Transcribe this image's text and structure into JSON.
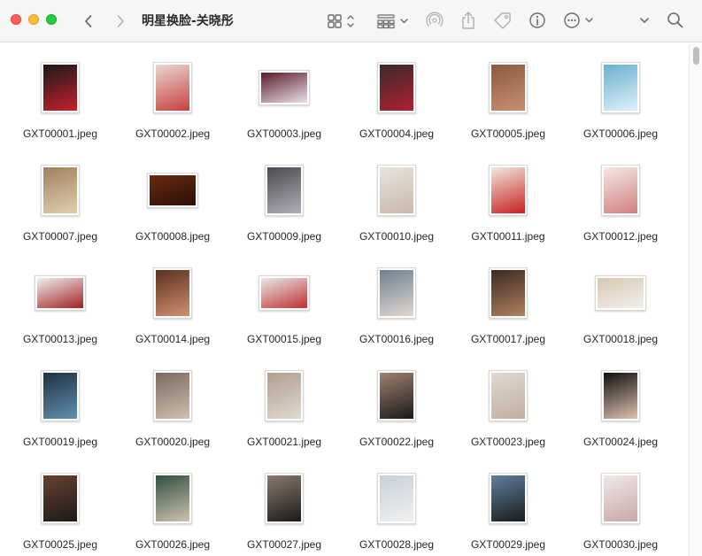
{
  "window": {
    "title": "明星换脸-关晓彤"
  },
  "toolbar": {
    "back_icon": "chevron-left-icon",
    "forward_icon": "chevron-right-icon",
    "view_icon": "icon-grid-view-icon",
    "group_icon": "group-list-icon",
    "airdrop_icon": "airdrop-icon",
    "share_icon": "share-icon",
    "tag_icon": "tag-icon",
    "info_icon": "info-icon",
    "more_icon": "ellipsis-circle-icon",
    "expand_icon": "chevron-down-icon",
    "search_icon": "search-icon"
  },
  "files": [
    {
      "name": "GXT00001.jpeg",
      "orient": "portrait",
      "colors": [
        "#1a1a1a",
        "#c8202a"
      ]
    },
    {
      "name": "GXT00002.jpeg",
      "orient": "portrait",
      "colors": [
        "#e8d8d0",
        "#c84040"
      ]
    },
    {
      "name": "GXT00003.jpeg",
      "orient": "landscape",
      "colors": [
        "#5a1a2a",
        "#e8e0e8"
      ]
    },
    {
      "name": "GXT00004.jpeg",
      "orient": "portrait",
      "colors": [
        "#3a2a2a",
        "#b02030"
      ]
    },
    {
      "name": "GXT00005.jpeg",
      "orient": "portrait",
      "colors": [
        "#8a5a40",
        "#c89070"
      ]
    },
    {
      "name": "GXT00006.jpeg",
      "orient": "portrait",
      "colors": [
        "#6ab0d0",
        "#e0f0f8"
      ]
    },
    {
      "name": "GXT00007.jpeg",
      "orient": "portrait",
      "colors": [
        "#a08060",
        "#e0d0b0"
      ]
    },
    {
      "name": "GXT00008.jpeg",
      "orient": "landscape",
      "colors": [
        "#6a2a10",
        "#2a1008"
      ]
    },
    {
      "name": "GXT00009.jpeg",
      "orient": "portrait",
      "colors": [
        "#4a4a50",
        "#b0b0b8"
      ]
    },
    {
      "name": "GXT00010.jpeg",
      "orient": "portrait",
      "colors": [
        "#e8e4e0",
        "#c8b8a8"
      ]
    },
    {
      "name": "GXT00011.jpeg",
      "orient": "portrait",
      "colors": [
        "#f0e8e0",
        "#c82020"
      ]
    },
    {
      "name": "GXT00012.jpeg",
      "orient": "portrait",
      "colors": [
        "#f4e8e4",
        "#d08080"
      ]
    },
    {
      "name": "GXT00013.jpeg",
      "orient": "landscape",
      "colors": [
        "#f0f0f0",
        "#a02020"
      ]
    },
    {
      "name": "GXT00014.jpeg",
      "orient": "portrait",
      "colors": [
        "#5a3020",
        "#d09070"
      ]
    },
    {
      "name": "GXT00015.jpeg",
      "orient": "landscape",
      "colors": [
        "#e8e8e8",
        "#c03030"
      ]
    },
    {
      "name": "GXT00016.jpeg",
      "orient": "portrait",
      "colors": [
        "#708090",
        "#e0d8d0"
      ]
    },
    {
      "name": "GXT00017.jpeg",
      "orient": "portrait",
      "colors": [
        "#3a2a20",
        "#b08060"
      ]
    },
    {
      "name": "GXT00018.jpeg",
      "orient": "landscape",
      "colors": [
        "#d8c8b0",
        "#f0f0f0"
      ]
    },
    {
      "name": "GXT00019.jpeg",
      "orient": "portrait",
      "colors": [
        "#203040",
        "#6090b0"
      ]
    },
    {
      "name": "GXT00020.jpeg",
      "orient": "portrait",
      "colors": [
        "#7a6a60",
        "#d0c0b0"
      ]
    },
    {
      "name": "GXT00021.jpeg",
      "orient": "portrait",
      "colors": [
        "#b0a090",
        "#e0d8d0"
      ]
    },
    {
      "name": "GXT00022.jpeg",
      "orient": "portrait",
      "colors": [
        "#a08070",
        "#1a1a1a"
      ]
    },
    {
      "name": "GXT00023.jpeg",
      "orient": "portrait",
      "colors": [
        "#e0d8d0",
        "#c0b0a0"
      ]
    },
    {
      "name": "GXT00024.jpeg",
      "orient": "portrait",
      "colors": [
        "#101010",
        "#e0c0b0"
      ]
    },
    {
      "name": "GXT00025.jpeg",
      "orient": "portrait",
      "colors": [
        "#6a4030",
        "#1a1a1a"
      ]
    },
    {
      "name": "GXT00026.jpeg",
      "orient": "portrait",
      "colors": [
        "#305040",
        "#d0c0b0"
      ]
    },
    {
      "name": "GXT00027.jpeg",
      "orient": "portrait",
      "colors": [
        "#8a7a70",
        "#1a1a1a"
      ]
    },
    {
      "name": "GXT00028.jpeg",
      "orient": "portrait",
      "colors": [
        "#c8d0d8",
        "#f0f0f0"
      ]
    },
    {
      "name": "GXT00029.jpeg",
      "orient": "portrait",
      "colors": [
        "#6080a0",
        "#1a1a1a"
      ]
    },
    {
      "name": "GXT00030.jpeg",
      "orient": "portrait",
      "colors": [
        "#f0e8e8",
        "#c8a8a8"
      ]
    }
  ]
}
